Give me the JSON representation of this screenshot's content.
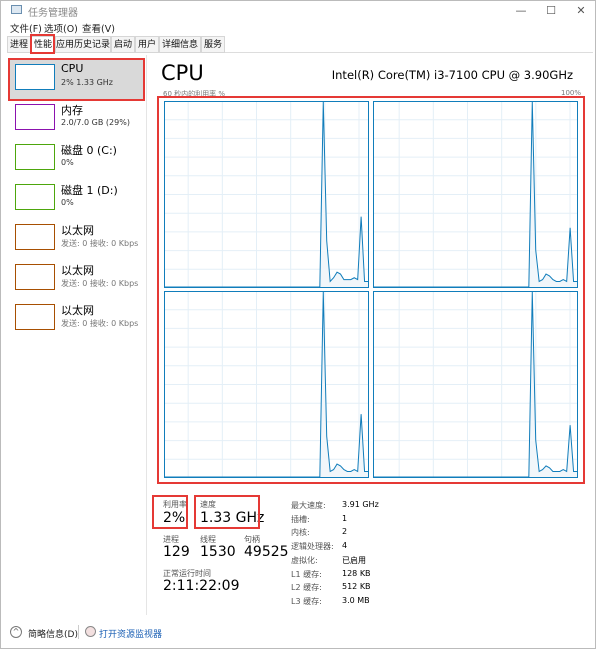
{
  "window": {
    "title": "任务管理器",
    "controls": [
      "—",
      "☐",
      "✕"
    ]
  },
  "menu": [
    "文件(F)",
    "选项(O)",
    "查看(V)"
  ],
  "tabs": [
    "进程",
    "性能",
    "应用历史记录",
    "启动",
    "用户",
    "详细信息",
    "服务"
  ],
  "active_tab": "性能",
  "sidebar": [
    {
      "name": "CPU",
      "sub": "2% 1.33 GHz",
      "color": "#117dbb",
      "selected": true
    },
    {
      "name": "内存",
      "sub": "2.0/7.0 GB (29%)",
      "color": "#8b12ae"
    },
    {
      "name": "磁盘 0 (C:)",
      "sub": "0%",
      "color": "#4da60c"
    },
    {
      "name": "磁盘 1 (D:)",
      "sub": "0%",
      "color": "#4da60c"
    },
    {
      "name": "以太网",
      "sub": "发送: 0 接收: 0 Kbps",
      "color": "#a74f01"
    },
    {
      "name": "以太网",
      "sub": "发送: 0 接收: 0 Kbps",
      "color": "#a74f01"
    },
    {
      "name": "以太网",
      "sub": "发送: 0 接收: 0 Kbps",
      "color": "#a74f01"
    }
  ],
  "main": {
    "title": "CPU",
    "model": "Intel(R) Core(TM) i3-7100 CPU @ 3.90GHz",
    "graph_label": "60 秒内的利用率 %",
    "graph_max": "100%",
    "line_color": "#117dbb"
  },
  "chart_data": {
    "type": "area",
    "ylim": [
      0,
      100
    ],
    "x_range_seconds": 60,
    "grid": true,
    "series": [
      {
        "values": [
          0,
          0,
          0,
          0,
          0,
          0,
          0,
          0,
          0,
          0,
          0,
          0,
          0,
          0,
          0,
          0,
          0,
          0,
          0,
          0,
          0,
          0,
          0,
          0,
          0,
          0,
          0,
          0,
          0,
          0,
          0,
          0,
          0,
          0,
          0,
          0,
          0,
          0,
          0,
          0,
          0,
          0,
          0,
          0,
          0,
          0,
          100,
          25,
          3,
          5,
          8,
          7,
          4,
          4,
          4,
          5,
          4,
          38,
          3,
          3
        ]
      },
      {
        "values": [
          0,
          0,
          0,
          0,
          0,
          0,
          0,
          0,
          0,
          0,
          0,
          0,
          0,
          0,
          0,
          0,
          0,
          0,
          0,
          0,
          0,
          0,
          0,
          0,
          0,
          0,
          0,
          0,
          0,
          0,
          0,
          0,
          0,
          0,
          0,
          0,
          0,
          0,
          0,
          0,
          0,
          0,
          0,
          0,
          0,
          0,
          100,
          20,
          3,
          4,
          7,
          6,
          4,
          3,
          3,
          4,
          3,
          32,
          3,
          3
        ]
      },
      {
        "values": [
          0,
          0,
          0,
          0,
          0,
          0,
          0,
          0,
          0,
          0,
          0,
          0,
          0,
          0,
          0,
          0,
          0,
          0,
          0,
          0,
          0,
          0,
          0,
          0,
          0,
          0,
          0,
          0,
          0,
          0,
          0,
          0,
          0,
          0,
          0,
          0,
          0,
          0,
          0,
          0,
          0,
          0,
          0,
          0,
          0,
          0,
          100,
          22,
          3,
          4,
          7,
          6,
          4,
          3,
          3,
          4,
          3,
          34,
          3,
          3
        ]
      },
      {
        "values": [
          0,
          0,
          0,
          0,
          0,
          0,
          0,
          0,
          0,
          0,
          0,
          0,
          0,
          0,
          0,
          0,
          0,
          0,
          0,
          0,
          0,
          0,
          0,
          0,
          0,
          0,
          0,
          0,
          0,
          0,
          0,
          0,
          0,
          0,
          0,
          0,
          0,
          0,
          0,
          0,
          0,
          0,
          0,
          0,
          0,
          0,
          100,
          20,
          3,
          4,
          6,
          5,
          3,
          3,
          3,
          4,
          3,
          28,
          3,
          3
        ]
      }
    ]
  },
  "stats": {
    "util_label": "利用率",
    "util": "2%",
    "speed_label": "速度",
    "speed": "1.33 GHz",
    "proc_label": "进程",
    "proc": "129",
    "thread_label": "线程",
    "thread": "1530",
    "handle_label": "句柄",
    "handle": "49525",
    "uptime_label": "正常运行时间",
    "uptime": "2:11:22:09"
  },
  "specs": [
    [
      "最大速度:",
      "3.91 GHz"
    ],
    [
      "插槽:",
      "1"
    ],
    [
      "内核:",
      "2"
    ],
    [
      "逻辑处理器:",
      "4"
    ],
    [
      "虚拟化:",
      "已启用"
    ],
    [
      "L1 缓存:",
      "128 KB"
    ],
    [
      "L2 缓存:",
      "512 KB"
    ],
    [
      "L3 缓存:",
      "3.0 MB"
    ]
  ],
  "footer": {
    "summary": "简略信息(D)",
    "monitor": "打开资源监视器"
  }
}
